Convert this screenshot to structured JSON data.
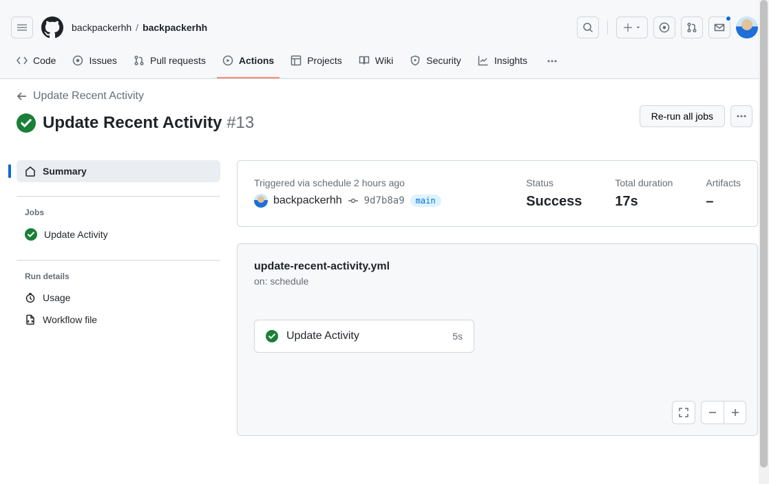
{
  "breadcrumb": {
    "owner": "backpackerhh",
    "repo": "backpackerhh"
  },
  "nav": {
    "code": "Code",
    "issues": "Issues",
    "pulls": "Pull requests",
    "actions": "Actions",
    "projects": "Projects",
    "wiki": "Wiki",
    "security": "Security",
    "insights": "Insights"
  },
  "back_label": "Update Recent Activity",
  "run": {
    "title": "Update Recent Activity",
    "number": "#13",
    "rerun_label": "Re-run all jobs"
  },
  "sidebar": {
    "summary": "Summary",
    "jobs_header": "Jobs",
    "jobs": [
      {
        "name": "Update Activity"
      }
    ],
    "details_header": "Run details",
    "usage": "Usage",
    "workflow_file": "Workflow file"
  },
  "meta": {
    "trigger_prefix": "Triggered via schedule",
    "trigger_time": "2 hours ago",
    "actor": "backpackerhh",
    "commit": "9d7b8a9",
    "branch": "main",
    "status_label": "Status",
    "status_value": "Success",
    "duration_label": "Total duration",
    "duration_value": "17s",
    "artifacts_label": "Artifacts",
    "artifacts_value": "–"
  },
  "graph": {
    "workflow_file": "update-recent-activity.yml",
    "on_label": "on: schedule",
    "job": {
      "name": "Update Activity",
      "duration": "5s"
    }
  }
}
